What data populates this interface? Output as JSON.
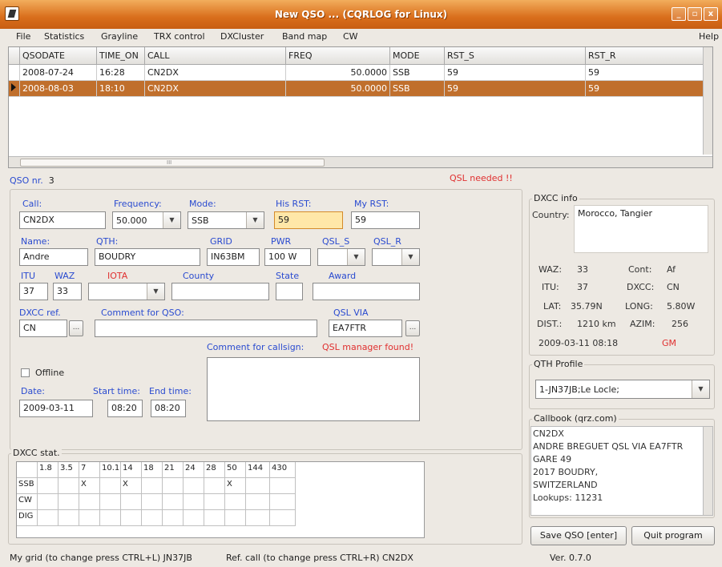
{
  "window": {
    "title": "New QSO ... (CQRLOG for Linux)",
    "min": "_",
    "max": "▫",
    "close": "x"
  },
  "menu": [
    "File",
    "Statistics",
    "Grayline",
    "TRX control",
    "DXCluster",
    "Band map",
    "CW"
  ],
  "menu_help": "Help",
  "table": {
    "columns": [
      "QSODATE",
      "TIME_ON",
      "CALL",
      "FREQ",
      "MODE",
      "RST_S",
      "RST_R"
    ],
    "rows": [
      [
        "2008-07-24",
        "16:28",
        "CN2DX",
        "50.0000",
        "SSB",
        "59",
        "59"
      ],
      [
        "2008-08-03",
        "18:10",
        "CN2DX",
        "50.0000",
        "SSB",
        "59",
        "59"
      ]
    ],
    "scroll_mark": "III"
  },
  "qso_nr_label": "QSO nr.",
  "qso_nr": "3",
  "qsl_needed": "QSL needed !!",
  "form": {
    "call_label": "Call:",
    "call": "CN2DX",
    "freq_label": "Frequency:",
    "freq": "50.000",
    "mode_label": "Mode:",
    "mode": "SSB",
    "his_rst_label": "His RST:",
    "his_rst": "59",
    "my_rst_label": "My RST:",
    "my_rst": "59",
    "name_label": "Name:",
    "name": "Andre",
    "qth_label": "QTH:",
    "qth": "BOUDRY",
    "grid_label": "GRID",
    "grid": "IN63BM",
    "pwr_label": "PWR",
    "pwr": "100 W",
    "qsl_s_label": "QSL_S",
    "qsl_r_label": "QSL_R",
    "itu_label": "ITU",
    "itu": "37",
    "waz_label": "WAZ",
    "waz": "33",
    "iota_label": "IOTA",
    "county_label": "County",
    "state_label": "State",
    "award_label": "Award",
    "dxcc_ref_label": "DXCC ref.",
    "dxcc_ref": "CN",
    "comment_qso_label": "Comment for QSO:",
    "qsl_via_label": "QSL VIA",
    "qsl_via": "EA7FTR",
    "comment_call_label": "Comment for callsign:",
    "qsl_manager": "QSL manager found!",
    "offline_label": "Offline",
    "date_label": "Date:",
    "date": "2009-03-11",
    "start_label": "Start time:",
    "start": "08:20",
    "end_label": "End time:",
    "end": "08:20",
    "dots": "..."
  },
  "dxcc_info": {
    "title": "DXCC info",
    "country_label": "Country:",
    "country": "Morocco, Tangier",
    "waz_label": "WAZ:",
    "waz": "33",
    "cont_label": "Cont:",
    "cont": "Af",
    "itu_label": "ITU:",
    "itu": "37",
    "dxcc_label": "DXCC:",
    "dxcc": "CN",
    "lat_label": "LAT:",
    "lat": "35.79N",
    "long_label": "LONG:",
    "long": "5.80W",
    "dist_label": "DIST.:",
    "dist": "1210 km",
    "azim_label": "AZIM:",
    "azim": "256",
    "datetime": "2009-03-11  08:18",
    "gm": "GM"
  },
  "qth_profile": {
    "title": "QTH Profile",
    "value": "1-JN37JB;Le Locle;"
  },
  "callbook": {
    "title": "Callbook (qrz.com)",
    "lines": [
      "CN2DX",
      "ANDRE BREGUET QSL VIA EA7FTR",
      "GARE 49",
      "2017 BOUDRY,",
      "SWITZERLAND",
      "Lookups:  11231"
    ]
  },
  "buttons": {
    "save": "Save QSO [enter]",
    "quit": "Quit program"
  },
  "dxcc_stat": {
    "title": "DXCC stat.",
    "bands": [
      "1.8",
      "3.5",
      "7",
      "10.1",
      "14",
      "18",
      "21",
      "24",
      "28",
      "50",
      "144",
      "430"
    ],
    "modes": [
      "SSB",
      "CW",
      "DIG"
    ],
    "marks": {
      "SSB": [
        "7",
        "14",
        "50"
      ],
      "CW": [],
      "DIG": []
    },
    "mark": "X"
  },
  "status": {
    "grid": "My grid (to change press CTRL+L) JN37JB",
    "ref": "Ref. call (to change press CTRL+R)   CN2DX",
    "ver": "Ver. 0.7.0"
  }
}
